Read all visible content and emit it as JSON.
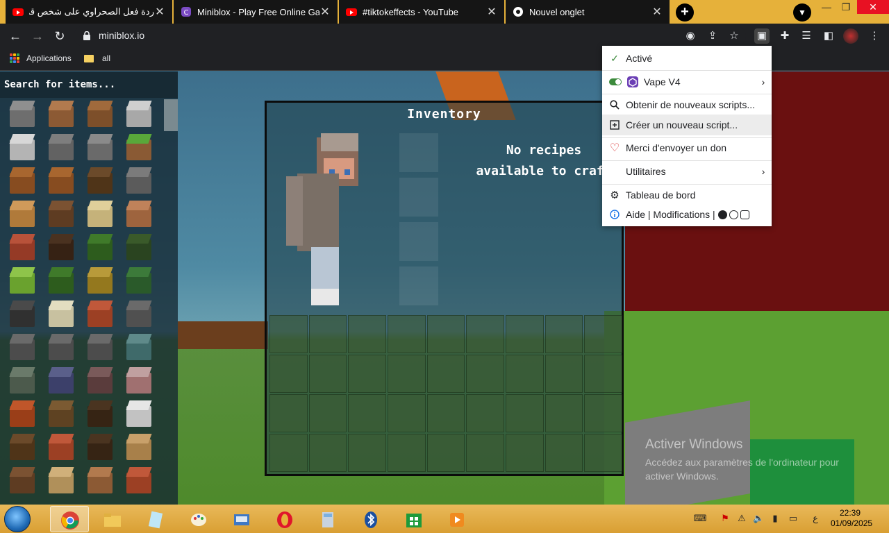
{
  "tabs": [
    {
      "title": "ردة فعل الصحراوي على شخص قدر",
      "icon": "youtube-icon"
    },
    {
      "title": "Miniblox - Play Free Online Game",
      "icon": "miniblox-icon"
    },
    {
      "title": "#tiktokeffects - YouTube",
      "icon": "youtube-icon"
    },
    {
      "title": "Nouvel onglet",
      "icon": "chrome-icon"
    }
  ],
  "new_tab_label": "+",
  "address": {
    "url": "miniblox.io"
  },
  "bookmarks": [
    {
      "label": "Applications",
      "icon": "apps-grid-icon"
    },
    {
      "label": "all",
      "icon": "folder-icon"
    }
  ],
  "game": {
    "search_placeholder": "Search for items...",
    "inventory_title": "Inventory",
    "no_recipes": "No recipes\navailable to craft"
  },
  "extension_menu": {
    "items": [
      {
        "label": "Activé",
        "icon": "check-icon"
      },
      {
        "label": "Vape V4",
        "icon": "vape-icon",
        "has_submenu": true,
        "enabled": true
      },
      {
        "label": "Obtenir de nouveaux scripts...",
        "icon": "search-icon"
      },
      {
        "label": "Créer un nouveau script...",
        "icon": "plus-box-icon"
      },
      {
        "label": "Merci d'envoyer un don",
        "icon": "heart-icon"
      },
      {
        "label": "Utilitaires",
        "icon": "",
        "has_submenu": true
      },
      {
        "label": "Tableau de bord",
        "icon": "gear-icon"
      },
      {
        "label": "Aide | Modifications |",
        "icon": "info-icon"
      }
    ]
  },
  "watermark": {
    "title": "Activer Windows",
    "body": "Accédez aux paramètres de l'ordinateur pour activer Windows."
  },
  "taskbar": {
    "time": "22:39",
    "date": "01/09/2025",
    "lang": "ع"
  },
  "colors": {
    "tabstrip": "#e6b13a",
    "toolbar": "#202124",
    "accent_green": "#3c8a3c",
    "vape_purple": "#6b3fb5"
  }
}
